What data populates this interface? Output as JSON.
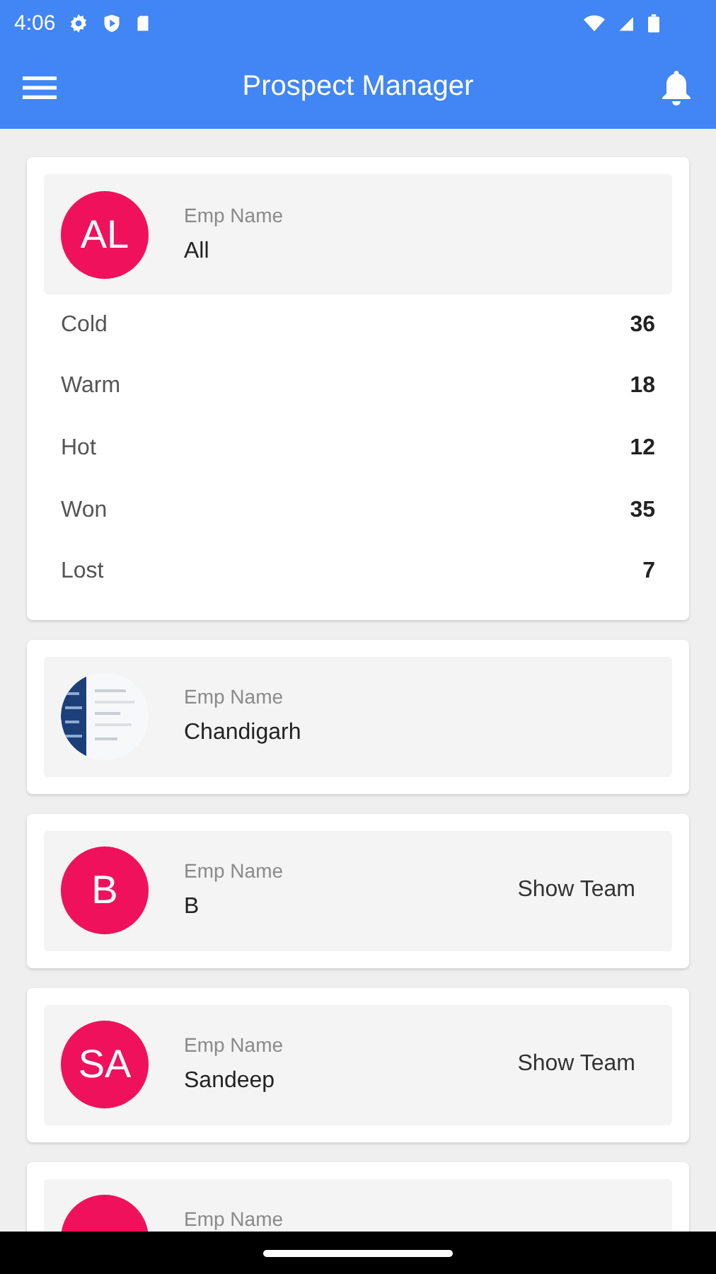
{
  "status_bar": {
    "time": "4:06"
  },
  "app_bar": {
    "title": "Prospect Manager"
  },
  "cards": [
    {
      "avatar": {
        "kind": "initials",
        "initials": "AL"
      },
      "label": "Emp Name",
      "name": "All",
      "stats": [
        {
          "label": "Cold",
          "value": "36"
        },
        {
          "label": "Warm",
          "value": "18"
        },
        {
          "label": "Hot",
          "value": "12"
        },
        {
          "label": "Won",
          "value": "35"
        },
        {
          "label": "Lost",
          "value": "7"
        }
      ]
    },
    {
      "label": "Emp Name",
      "name": "Chandigarh"
    },
    {
      "avatar": {
        "kind": "initials",
        "initials": "B"
      },
      "label": "Emp Name",
      "name": "B",
      "action": "Show Team"
    },
    {
      "avatar": {
        "kind": "initials",
        "initials": "SA"
      },
      "label": "Emp Name",
      "name": "Sandeep",
      "action": "Show Team"
    },
    {
      "avatar": {
        "kind": "initials"
      },
      "label": "Emp Name"
    }
  ]
}
